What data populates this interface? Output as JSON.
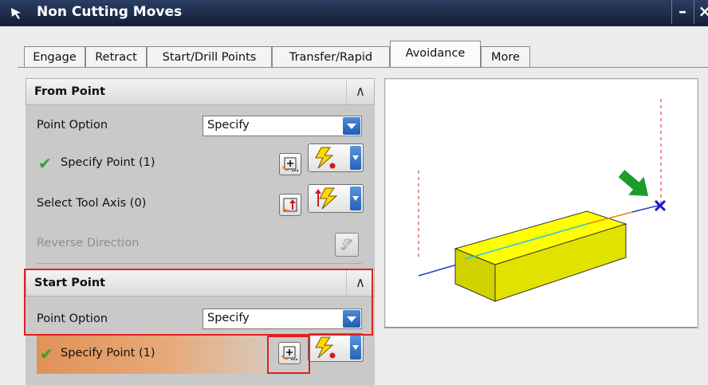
{
  "window": {
    "title": "Non Cutting Moves",
    "minimize_glyph": "–",
    "close_glyph": "×"
  },
  "tabs": [
    {
      "label": "Engage"
    },
    {
      "label": "Retract"
    },
    {
      "label": "Start/Drill Points"
    },
    {
      "label": "Transfer/Rapid"
    },
    {
      "label": "Avoidance",
      "active": true
    },
    {
      "label": "More"
    }
  ],
  "from_point": {
    "header": "From Point",
    "point_option_label": "Point Option",
    "point_option_value": "Specify",
    "specify_point_label": "Specify Point (1)",
    "select_tool_axis_label": "Select Tool Axis (0)",
    "reverse_direction_label": "Reverse Direction"
  },
  "start_point": {
    "header": "Start Point",
    "point_option_label": "Point Option",
    "point_option_value": "Specify",
    "specify_point_label": "Specify Point (1)"
  },
  "icons": {
    "window_icon": "mouse-pointer-icon",
    "collapse": "chevron-up-icon",
    "check": "checkmark-icon",
    "point_dialog": "point-dialog-icon",
    "inferred_point": "lightning-point-icon",
    "vector_dialog": "vector-dialog-icon",
    "reverse": "reverse-direction-icon",
    "dropdown": "chevron-down-icon"
  },
  "colors": {
    "titlebar": "#1d2e4d",
    "panel": "#c9c9c9",
    "highlight_box": "#e02020",
    "selected_row": "#e39b64",
    "check": "#2fa32a",
    "block_face": "#ffff00",
    "arrow": "#1f9b2a"
  }
}
